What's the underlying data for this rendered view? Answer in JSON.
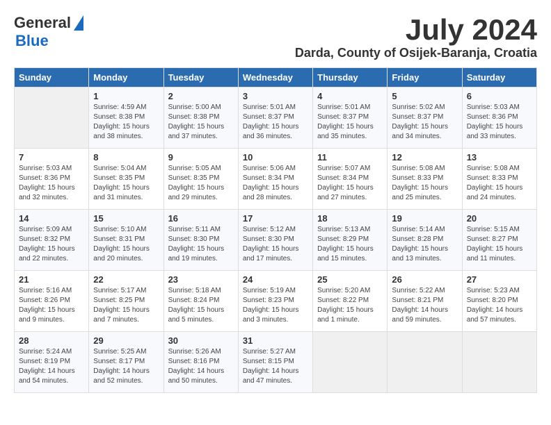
{
  "header": {
    "logo_general": "General",
    "logo_blue": "Blue",
    "month_year": "July 2024",
    "location": "Darda, County of Osijek-Baranja, Croatia"
  },
  "calendar": {
    "days_of_week": [
      "Sunday",
      "Monday",
      "Tuesday",
      "Wednesday",
      "Thursday",
      "Friday",
      "Saturday"
    ],
    "weeks": [
      [
        {
          "day": "",
          "content": ""
        },
        {
          "day": "1",
          "content": "Sunrise: 4:59 AM\nSunset: 8:38 PM\nDaylight: 15 hours\nand 38 minutes."
        },
        {
          "day": "2",
          "content": "Sunrise: 5:00 AM\nSunset: 8:38 PM\nDaylight: 15 hours\nand 37 minutes."
        },
        {
          "day": "3",
          "content": "Sunrise: 5:01 AM\nSunset: 8:37 PM\nDaylight: 15 hours\nand 36 minutes."
        },
        {
          "day": "4",
          "content": "Sunrise: 5:01 AM\nSunset: 8:37 PM\nDaylight: 15 hours\nand 35 minutes."
        },
        {
          "day": "5",
          "content": "Sunrise: 5:02 AM\nSunset: 8:37 PM\nDaylight: 15 hours\nand 34 minutes."
        },
        {
          "day": "6",
          "content": "Sunrise: 5:03 AM\nSunset: 8:36 PM\nDaylight: 15 hours\nand 33 minutes."
        }
      ],
      [
        {
          "day": "7",
          "content": "Sunrise: 5:03 AM\nSunset: 8:36 PM\nDaylight: 15 hours\nand 32 minutes."
        },
        {
          "day": "8",
          "content": "Sunrise: 5:04 AM\nSunset: 8:35 PM\nDaylight: 15 hours\nand 31 minutes."
        },
        {
          "day": "9",
          "content": "Sunrise: 5:05 AM\nSunset: 8:35 PM\nDaylight: 15 hours\nand 29 minutes."
        },
        {
          "day": "10",
          "content": "Sunrise: 5:06 AM\nSunset: 8:34 PM\nDaylight: 15 hours\nand 28 minutes."
        },
        {
          "day": "11",
          "content": "Sunrise: 5:07 AM\nSunset: 8:34 PM\nDaylight: 15 hours\nand 27 minutes."
        },
        {
          "day": "12",
          "content": "Sunrise: 5:08 AM\nSunset: 8:33 PM\nDaylight: 15 hours\nand 25 minutes."
        },
        {
          "day": "13",
          "content": "Sunrise: 5:08 AM\nSunset: 8:33 PM\nDaylight: 15 hours\nand 24 minutes."
        }
      ],
      [
        {
          "day": "14",
          "content": "Sunrise: 5:09 AM\nSunset: 8:32 PM\nDaylight: 15 hours\nand 22 minutes."
        },
        {
          "day": "15",
          "content": "Sunrise: 5:10 AM\nSunset: 8:31 PM\nDaylight: 15 hours\nand 20 minutes."
        },
        {
          "day": "16",
          "content": "Sunrise: 5:11 AM\nSunset: 8:30 PM\nDaylight: 15 hours\nand 19 minutes."
        },
        {
          "day": "17",
          "content": "Sunrise: 5:12 AM\nSunset: 8:30 PM\nDaylight: 15 hours\nand 17 minutes."
        },
        {
          "day": "18",
          "content": "Sunrise: 5:13 AM\nSunset: 8:29 PM\nDaylight: 15 hours\nand 15 minutes."
        },
        {
          "day": "19",
          "content": "Sunrise: 5:14 AM\nSunset: 8:28 PM\nDaylight: 15 hours\nand 13 minutes."
        },
        {
          "day": "20",
          "content": "Sunrise: 5:15 AM\nSunset: 8:27 PM\nDaylight: 15 hours\nand 11 minutes."
        }
      ],
      [
        {
          "day": "21",
          "content": "Sunrise: 5:16 AM\nSunset: 8:26 PM\nDaylight: 15 hours\nand 9 minutes."
        },
        {
          "day": "22",
          "content": "Sunrise: 5:17 AM\nSunset: 8:25 PM\nDaylight: 15 hours\nand 7 minutes."
        },
        {
          "day": "23",
          "content": "Sunrise: 5:18 AM\nSunset: 8:24 PM\nDaylight: 15 hours\nand 5 minutes."
        },
        {
          "day": "24",
          "content": "Sunrise: 5:19 AM\nSunset: 8:23 PM\nDaylight: 15 hours\nand 3 minutes."
        },
        {
          "day": "25",
          "content": "Sunrise: 5:20 AM\nSunset: 8:22 PM\nDaylight: 15 hours\nand 1 minute."
        },
        {
          "day": "26",
          "content": "Sunrise: 5:22 AM\nSunset: 8:21 PM\nDaylight: 14 hours\nand 59 minutes."
        },
        {
          "day": "27",
          "content": "Sunrise: 5:23 AM\nSunset: 8:20 PM\nDaylight: 14 hours\nand 57 minutes."
        }
      ],
      [
        {
          "day": "28",
          "content": "Sunrise: 5:24 AM\nSunset: 8:19 PM\nDaylight: 14 hours\nand 54 minutes."
        },
        {
          "day": "29",
          "content": "Sunrise: 5:25 AM\nSunset: 8:17 PM\nDaylight: 14 hours\nand 52 minutes."
        },
        {
          "day": "30",
          "content": "Sunrise: 5:26 AM\nSunset: 8:16 PM\nDaylight: 14 hours\nand 50 minutes."
        },
        {
          "day": "31",
          "content": "Sunrise: 5:27 AM\nSunset: 8:15 PM\nDaylight: 14 hours\nand 47 minutes."
        },
        {
          "day": "",
          "content": ""
        },
        {
          "day": "",
          "content": ""
        },
        {
          "day": "",
          "content": ""
        }
      ]
    ]
  }
}
